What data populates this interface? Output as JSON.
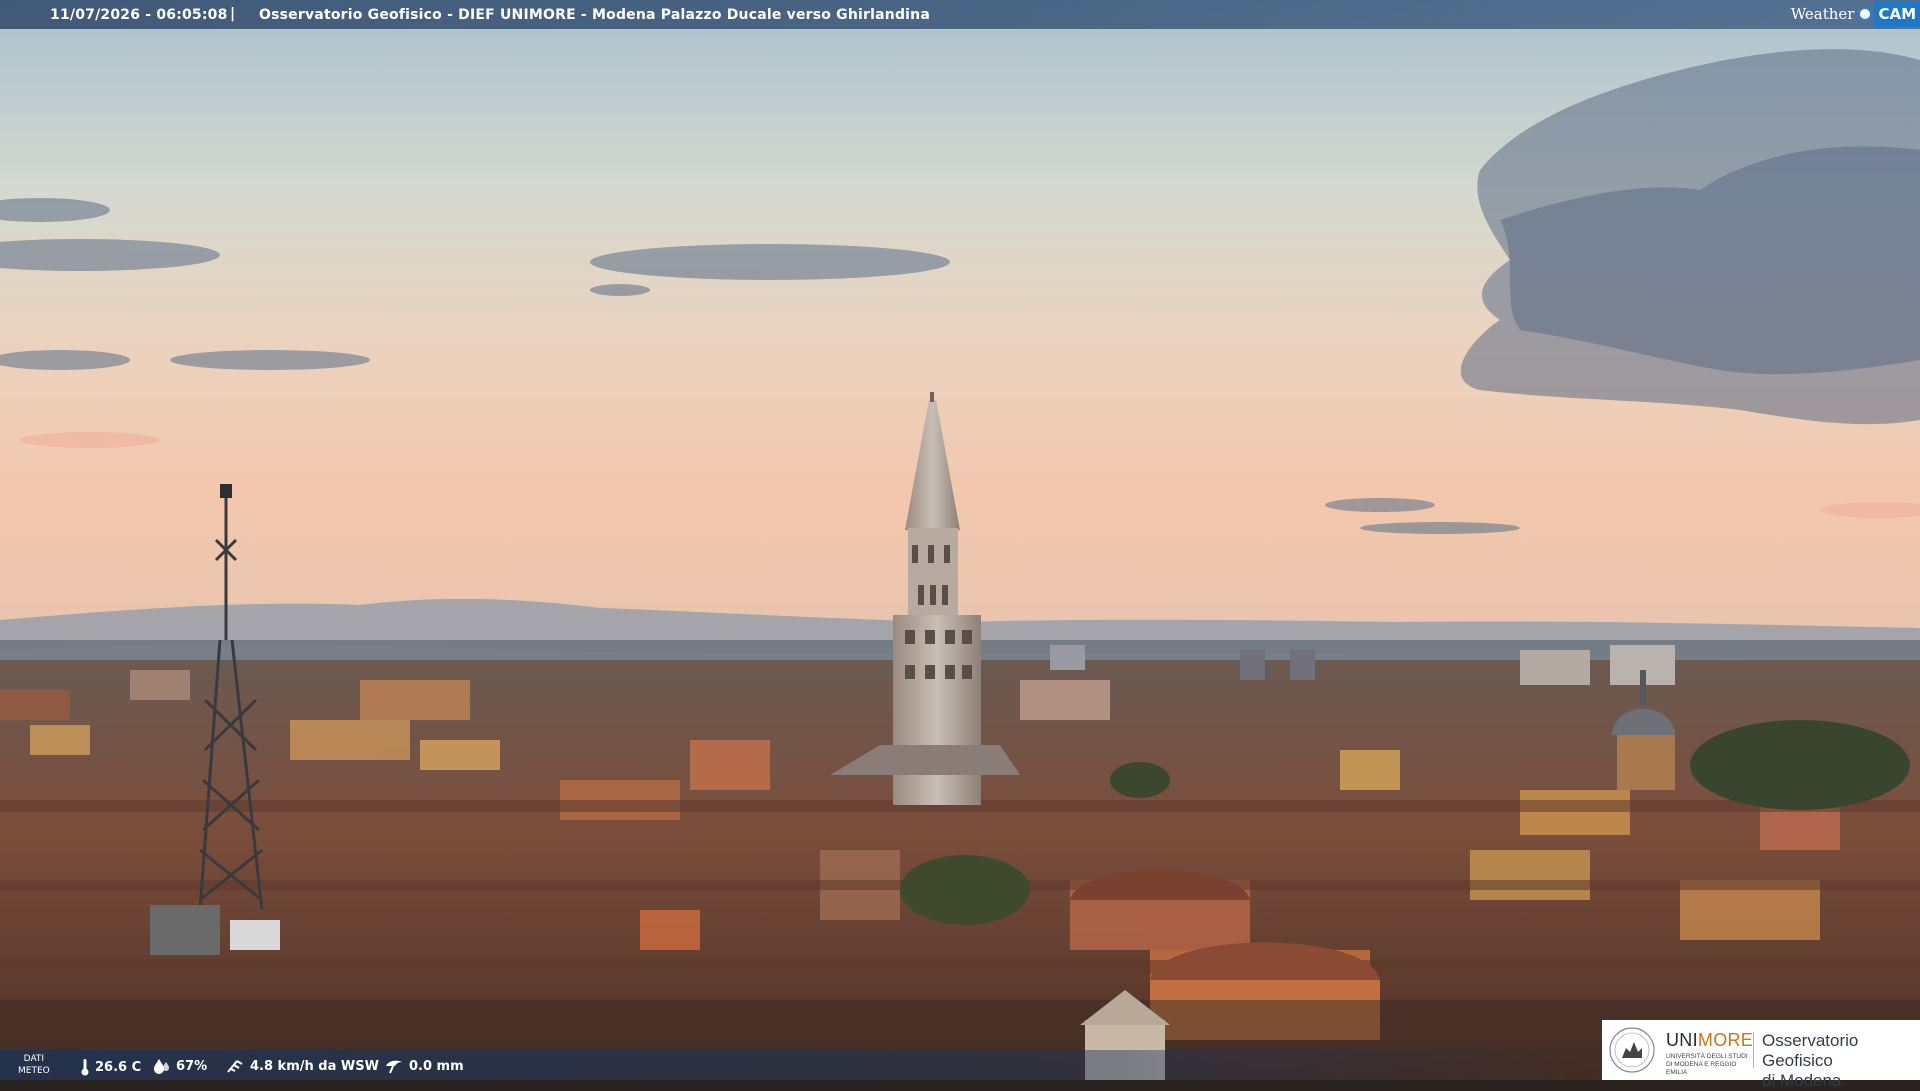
{
  "header": {
    "datetime": "11/07/2026 - 06:05:08",
    "separator": "|",
    "title": "Osservatorio Geofisico - DIEF UNIMORE - Modena Palazzo Ducale verso Ghirlandina"
  },
  "brand": {
    "weather_text": "Weather",
    "cam_text": "CAM"
  },
  "weather": {
    "label_line1": "DATI",
    "label_line2": "METEO",
    "temperature": "26.6 C",
    "humidity": "67%",
    "wind": "4.8 km/h da WSW",
    "rain": "0.0 mm",
    "icons": [
      "thermometer-icon",
      "humidity-drop-icon",
      "wind-icon",
      "rain-gauge-icon"
    ]
  },
  "logo": {
    "unimore_a": "UNI",
    "unimore_b": "MORE",
    "unimore_sub": "UNIVERSITÀ DEGLI STUDI DI MODENA E REGGIO EMILIA",
    "observatory_line1": "Osservatorio Geofisico",
    "observatory_line2": "di Modena"
  },
  "colors": {
    "sky_top": "#9fb8c8",
    "sky_mid": "#d8d6cc",
    "sky_horizon": "#f2c9b0",
    "roofs": "#7a4a36",
    "bar_blue": "#2a4c78",
    "unimore_orange": "#c8761a"
  }
}
